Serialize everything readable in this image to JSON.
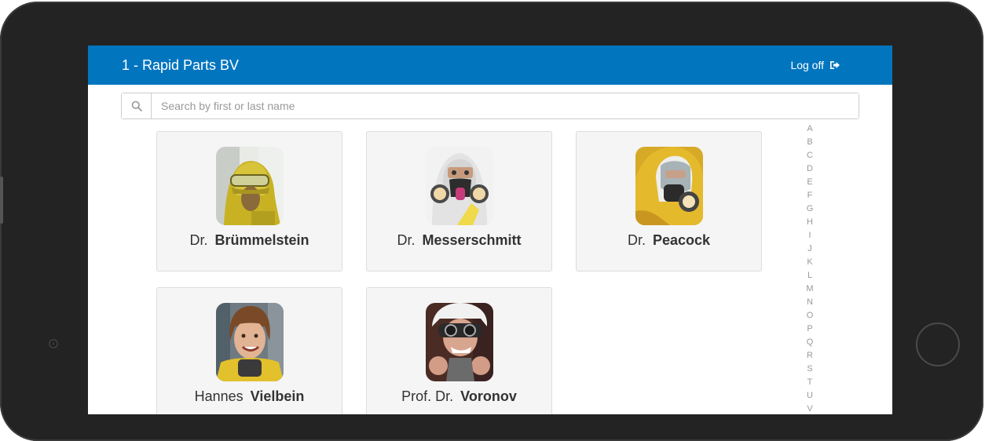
{
  "header": {
    "title": "1 - Rapid Parts BV",
    "logoff_label": "Log off"
  },
  "search": {
    "placeholder": "Search by first or last name",
    "value": ""
  },
  "people": [
    {
      "prefix": "Dr.",
      "surname": "Brümmelstein"
    },
    {
      "prefix": "Dr.",
      "surname": "Messerschmitt"
    },
    {
      "prefix": "Dr.",
      "surname": "Peacock"
    },
    {
      "prefix": "Hannes",
      "surname": "Vielbein"
    },
    {
      "prefix": "Prof. Dr.",
      "surname": "Voronov"
    }
  ],
  "alphabet": [
    "A",
    "B",
    "C",
    "D",
    "E",
    "F",
    "G",
    "H",
    "I",
    "J",
    "K",
    "L",
    "M",
    "N",
    "O",
    "P",
    "Q",
    "R",
    "S",
    "T",
    "U",
    "V"
  ],
  "colors": {
    "header_bg": "#0275bf",
    "card_bg": "#f5f5f5",
    "bezel": "#232323"
  }
}
